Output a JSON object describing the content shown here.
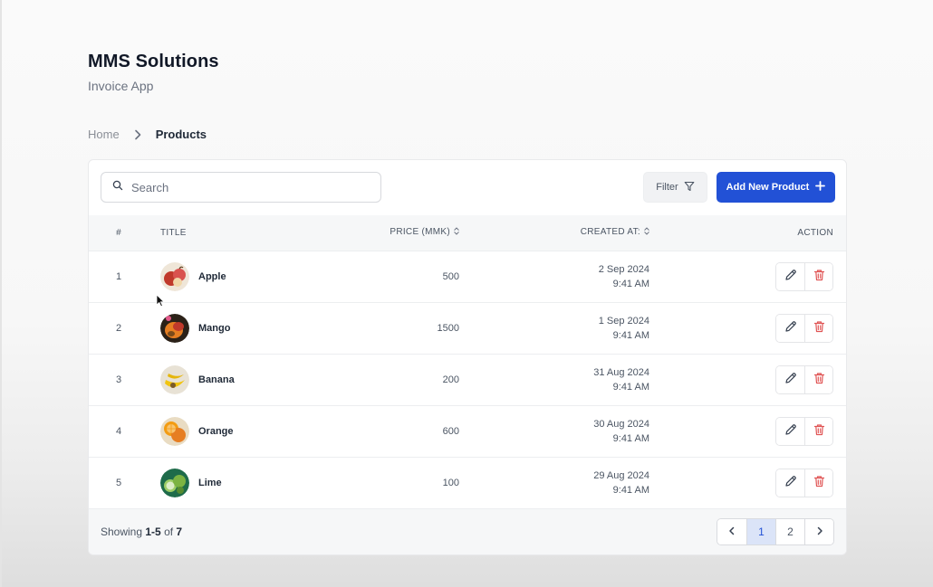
{
  "brand": {
    "title": "MMS Solutions",
    "subtitle": "Invoice App"
  },
  "breadcrumb": {
    "home": "Home",
    "current": "Products"
  },
  "toolbar": {
    "search_placeholder": "Search",
    "filter_label": "Filter",
    "add_label": "Add New Product"
  },
  "table": {
    "headers": {
      "num": "#",
      "title": "Title",
      "price": "Price (MMK)",
      "created": "Created At:",
      "action": "Action"
    },
    "rows": [
      {
        "num": "1",
        "title": "Apple",
        "price": "500",
        "date": "2 Sep 2024",
        "time": "9:41 AM",
        "thumb": "apple"
      },
      {
        "num": "2",
        "title": "Mango",
        "price": "1500",
        "date": "1 Sep 2024",
        "time": "9:41 AM",
        "thumb": "mango"
      },
      {
        "num": "3",
        "title": "Banana",
        "price": "200",
        "date": "31 Aug 2024",
        "time": "9:41 AM",
        "thumb": "banana"
      },
      {
        "num": "4",
        "title": "Orange",
        "price": "600",
        "date": "30 Aug 2024",
        "time": "9:41 AM",
        "thumb": "orange"
      },
      {
        "num": "5",
        "title": "Lime",
        "price": "100",
        "date": "29 Aug 2024",
        "time": "9:41 AM",
        "thumb": "lime"
      }
    ]
  },
  "footer": {
    "showing_prefix": "Showing",
    "showing_range": "1-5",
    "showing_of": "of",
    "showing_total": "7",
    "pages": [
      "1",
      "2"
    ],
    "current_page": "1"
  },
  "colors": {
    "primary": "#2251d6",
    "delete": "#e05555",
    "active_page_bg": "#dbe4f8"
  }
}
